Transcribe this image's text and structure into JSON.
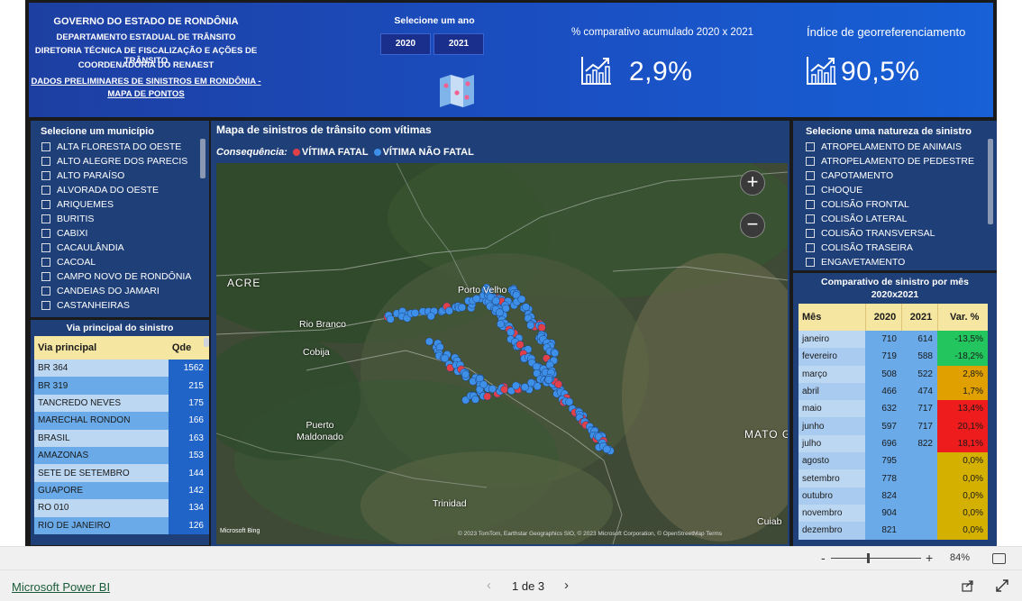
{
  "header": {
    "org_lines": [
      "GOVERNO  DO ESTADO DE RONDÔNIA",
      "DEPARTAMENTO ESTADUAL DE TRÂNSITO",
      "DIRETORIA TÉCNICA DE FISCALIZAÇÃO E AÇÕES DE TRÂNSITO",
      "COORDENADORIA DO RENAEST",
      "DADOS PRELIMINARES DE SINISTROS EM RONDÔNIA -",
      "MAPA DE PONTOS"
    ],
    "year_title": "Selecione um ano",
    "years": [
      "2020",
      "2021"
    ],
    "kpi1": {
      "label": "% comparativo acumulado 2020 x 2021",
      "value": "2,9%"
    },
    "kpi2": {
      "label": "Índice de georreferenciamento",
      "value": "90,5%"
    }
  },
  "municipios": {
    "title": "Selecione um município",
    "items": [
      "ALTA FLORESTA DO OESTE",
      "ALTO ALEGRE DOS PARECIS",
      "ALTO PARAÍSO",
      "ALVORADA DO OESTE",
      "ARIQUEMES",
      "BURITIS",
      "CABIXI",
      "CACAULÂNDIA",
      "CACOAL",
      "CAMPO NOVO DE RONDÔNIA",
      "CANDEIAS DO JAMARI",
      "CASTANHEIRAS"
    ]
  },
  "via": {
    "title": "Via principal do sinistro",
    "headers": [
      "Via principal",
      "Qde"
    ],
    "rows": [
      [
        "BR 364",
        "1562"
      ],
      [
        "BR 319",
        "215"
      ],
      [
        "TANCREDO NEVES",
        "175"
      ],
      [
        "MARECHAL RONDON",
        "166"
      ],
      [
        "BRASIL",
        "163"
      ],
      [
        "AMAZONAS",
        "153"
      ],
      [
        "SETE DE SETEMBRO",
        "144"
      ],
      [
        "GUAPORE",
        "142"
      ],
      [
        "RO 010",
        "134"
      ],
      [
        "RIO DE JANEIRO",
        "126"
      ]
    ]
  },
  "map": {
    "title": "Mapa de sinistros de trânsito com vítimas",
    "legend_title": "Consequência:",
    "legend_items": [
      {
        "label": "VÍTIMA FATAL",
        "color": "#e0404a"
      },
      {
        "label": "VÍTIMA NÃO FATAL",
        "color": "#3d8fe8"
      }
    ],
    "places": [
      "ACRE",
      "Rio Branco",
      "Porto Velho",
      "Cobija",
      "Puerto Maldonado",
      "Trinidad",
      "MATO G",
      "Cuiab"
    ],
    "zoom_in": "+",
    "zoom_out": "−",
    "bing": "Microsoft Bing",
    "credits": "© 2023 TomTom, Earthstar Geographics SIO, © 2023 Microsoft Corporation, © OpenStreetMap  Terms"
  },
  "natureza": {
    "title": "Selecione uma natureza de sinistro",
    "items": [
      "ATROPELAMENTO DE ANIMAIS",
      "ATROPELAMENTO DE PEDESTRE",
      "CAPOTAMENTO",
      "CHOQUE",
      "COLISÃO FRONTAL",
      "COLISÃO LATERAL",
      "COLISÃO TRANSVERSAL",
      "COLISÃO TRASEIRA",
      "ENGAVETAMENTO"
    ]
  },
  "monthly": {
    "title_line1": "Comparativo de sinistro por mês",
    "title_line2": "2020x2021",
    "headers": [
      "Mês",
      "2020",
      "2021",
      "Var. %"
    ],
    "rows": [
      {
        "mes": "janeiro",
        "y2020": "710",
        "y2021": "614",
        "var": "-13,5%",
        "color": "#22c55e"
      },
      {
        "mes": "fevereiro",
        "y2020": "719",
        "y2021": "588",
        "var": "-18,2%",
        "color": "#22c55e"
      },
      {
        "mes": "março",
        "y2020": "508",
        "y2021": "522",
        "var": "2,8%",
        "color": "#e0a000"
      },
      {
        "mes": "abril",
        "y2020": "466",
        "y2021": "474",
        "var": "1,7%",
        "color": "#e0a000"
      },
      {
        "mes": "maio",
        "y2020": "632",
        "y2021": "717",
        "var": "13,4%",
        "color": "#ee1c1c"
      },
      {
        "mes": "junho",
        "y2020": "597",
        "y2021": "717",
        "var": "20,1%",
        "color": "#ee1c1c"
      },
      {
        "mes": "julho",
        "y2020": "696",
        "y2021": "822",
        "var": "18,1%",
        "color": "#ee1c1c"
      },
      {
        "mes": "agosto",
        "y2020": "795",
        "y2021": "",
        "var": "0,0%",
        "color": "#d4b000"
      },
      {
        "mes": "setembro",
        "y2020": "778",
        "y2021": "",
        "var": "0,0%",
        "color": "#d4b000"
      },
      {
        "mes": "outubro",
        "y2020": "824",
        "y2021": "",
        "var": "0,0%",
        "color": "#d4b000"
      },
      {
        "mes": "novembro",
        "y2020": "904",
        "y2021": "",
        "var": "0,0%",
        "color": "#d4b000"
      },
      {
        "mes": "dezembro",
        "y2020": "821",
        "y2021": "",
        "var": "0,0%",
        "color": "#d4b000"
      }
    ]
  },
  "footer": {
    "pbi_label": "Microsoft Power BI",
    "page": "1 de 3",
    "zoom_minus": "-",
    "zoom_plus": "+",
    "zoom_percent": "84%"
  }
}
